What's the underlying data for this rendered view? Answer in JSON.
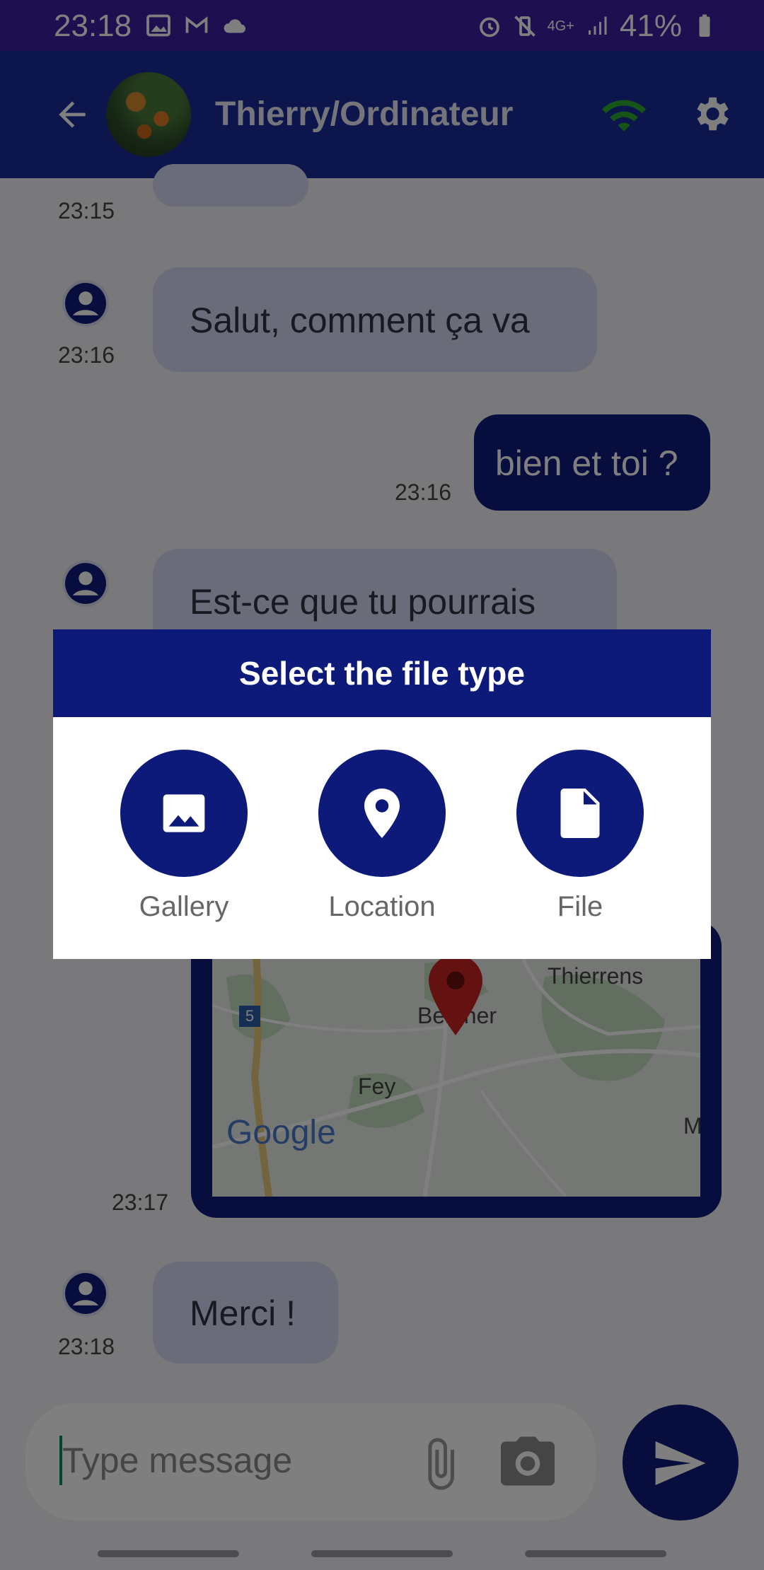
{
  "status_bar": {
    "time": "23:18",
    "battery": "41%",
    "network": "4G+"
  },
  "header": {
    "title": "Thierry/Ordinateur"
  },
  "messages": [
    {
      "direction": "in",
      "time": "23:15",
      "text": ""
    },
    {
      "direction": "in",
      "time": "23:16",
      "text": "Salut, comment ça va"
    },
    {
      "direction": "out",
      "time": "23:16",
      "text": "bien et toi ?"
    },
    {
      "direction": "in",
      "time": "",
      "text": "Est-ce que tu pourrais"
    },
    {
      "direction": "out",
      "time": "23:17",
      "type": "map",
      "map_labels": {
        "town1": "Bercher",
        "town2": "Thierrens",
        "town3": "Fey",
        "route": "5",
        "brand": "Google",
        "edge": "M"
      }
    },
    {
      "direction": "in",
      "time": "23:18",
      "text": "Merci !"
    }
  ],
  "input": {
    "placeholder": "Type message"
  },
  "dialog": {
    "title": "Select the file type",
    "options": [
      {
        "label": "Gallery",
        "icon": "image-icon"
      },
      {
        "label": "Location",
        "icon": "location-pin-icon"
      },
      {
        "label": "File",
        "icon": "file-icon"
      }
    ]
  },
  "colors": {
    "primary": "#0e1a7a",
    "status_bar": "#3a1ea0",
    "incoming_bubble": "#d7d8f2",
    "wifi": "#2ea82e"
  }
}
